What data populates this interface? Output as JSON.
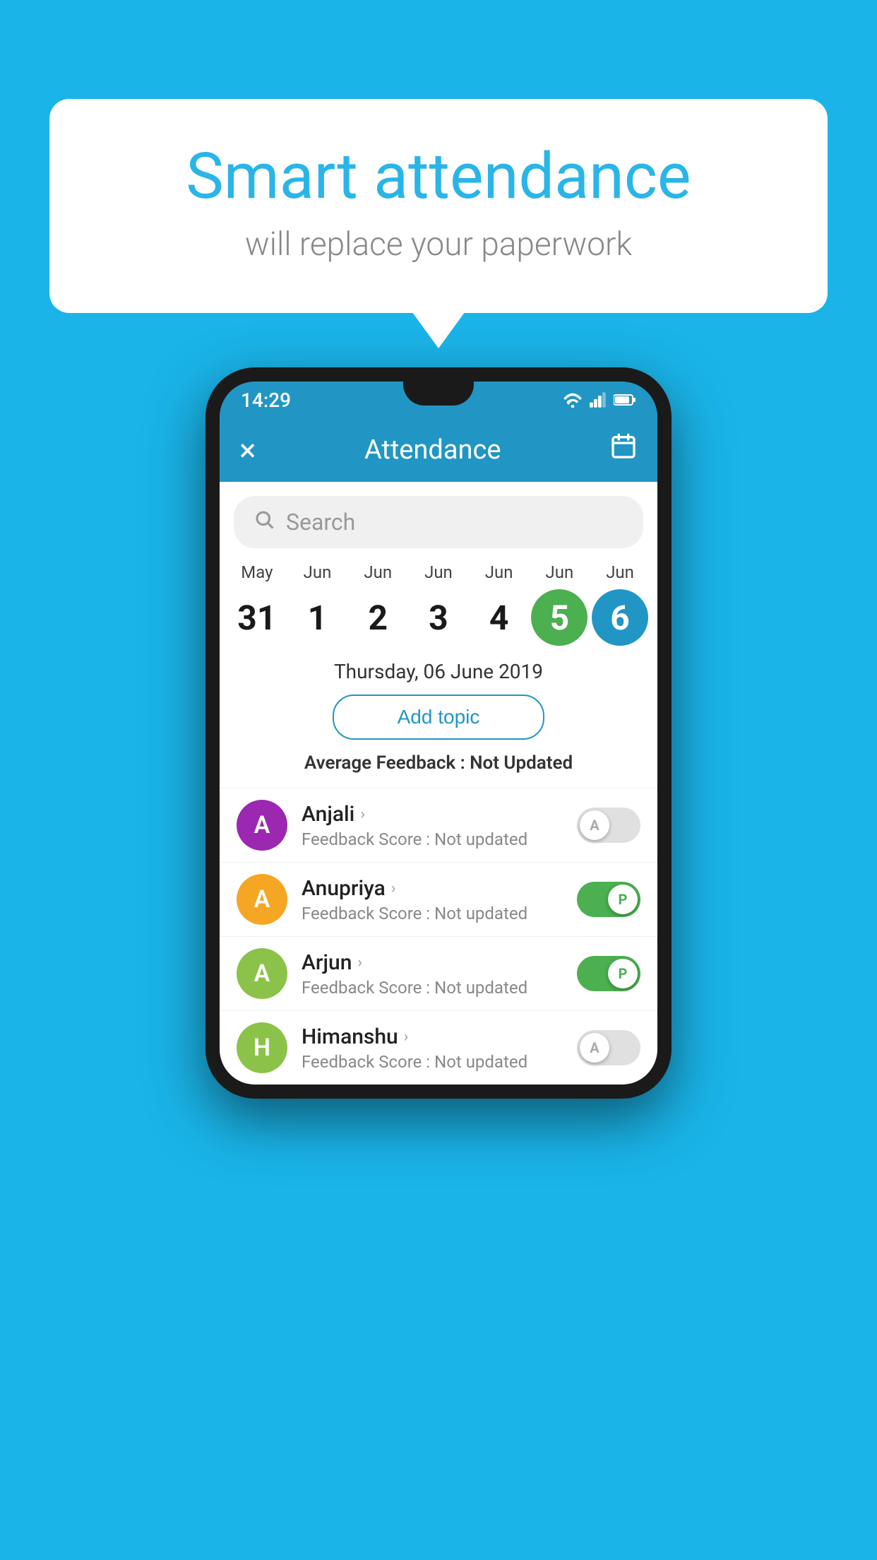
{
  "background_color": "#1ab4e8",
  "bubble": {
    "title": "Smart attendance",
    "subtitle": "will replace your paperwork"
  },
  "status_bar": {
    "time": "14:29",
    "icons": [
      "wifi",
      "signal",
      "battery"
    ]
  },
  "app_bar": {
    "close_label": "×",
    "title": "Attendance",
    "calendar_icon": "📅"
  },
  "search": {
    "placeholder": "Search"
  },
  "dates": [
    {
      "month": "May",
      "day": "31",
      "style": "normal"
    },
    {
      "month": "Jun",
      "day": "1",
      "style": "normal"
    },
    {
      "month": "Jun",
      "day": "2",
      "style": "normal"
    },
    {
      "month": "Jun",
      "day": "3",
      "style": "normal"
    },
    {
      "month": "Jun",
      "day": "4",
      "style": "normal"
    },
    {
      "month": "Jun",
      "day": "5",
      "style": "today"
    },
    {
      "month": "Jun",
      "day": "6",
      "style": "selected"
    }
  ],
  "selected_date_label": "Thursday, 06 June 2019",
  "add_topic_label": "Add topic",
  "avg_feedback_label": "Average Feedback :",
  "avg_feedback_value": "Not Updated",
  "students": [
    {
      "name": "Anjali",
      "initial": "A",
      "color": "#9c27b0",
      "feedback": "Not updated",
      "toggle": "off",
      "toggle_label": "A"
    },
    {
      "name": "Anupriya",
      "initial": "A",
      "color": "#f5a623",
      "feedback": "Not updated",
      "toggle": "on",
      "toggle_label": "P"
    },
    {
      "name": "Arjun",
      "initial": "A",
      "color": "#8bc34a",
      "feedback": "Not updated",
      "toggle": "on",
      "toggle_label": "P"
    },
    {
      "name": "Himanshu",
      "initial": "H",
      "color": "#8bc34a",
      "feedback": "Not updated",
      "toggle": "off",
      "toggle_label": "A"
    }
  ],
  "feedback_prefix": "Feedback Score : "
}
